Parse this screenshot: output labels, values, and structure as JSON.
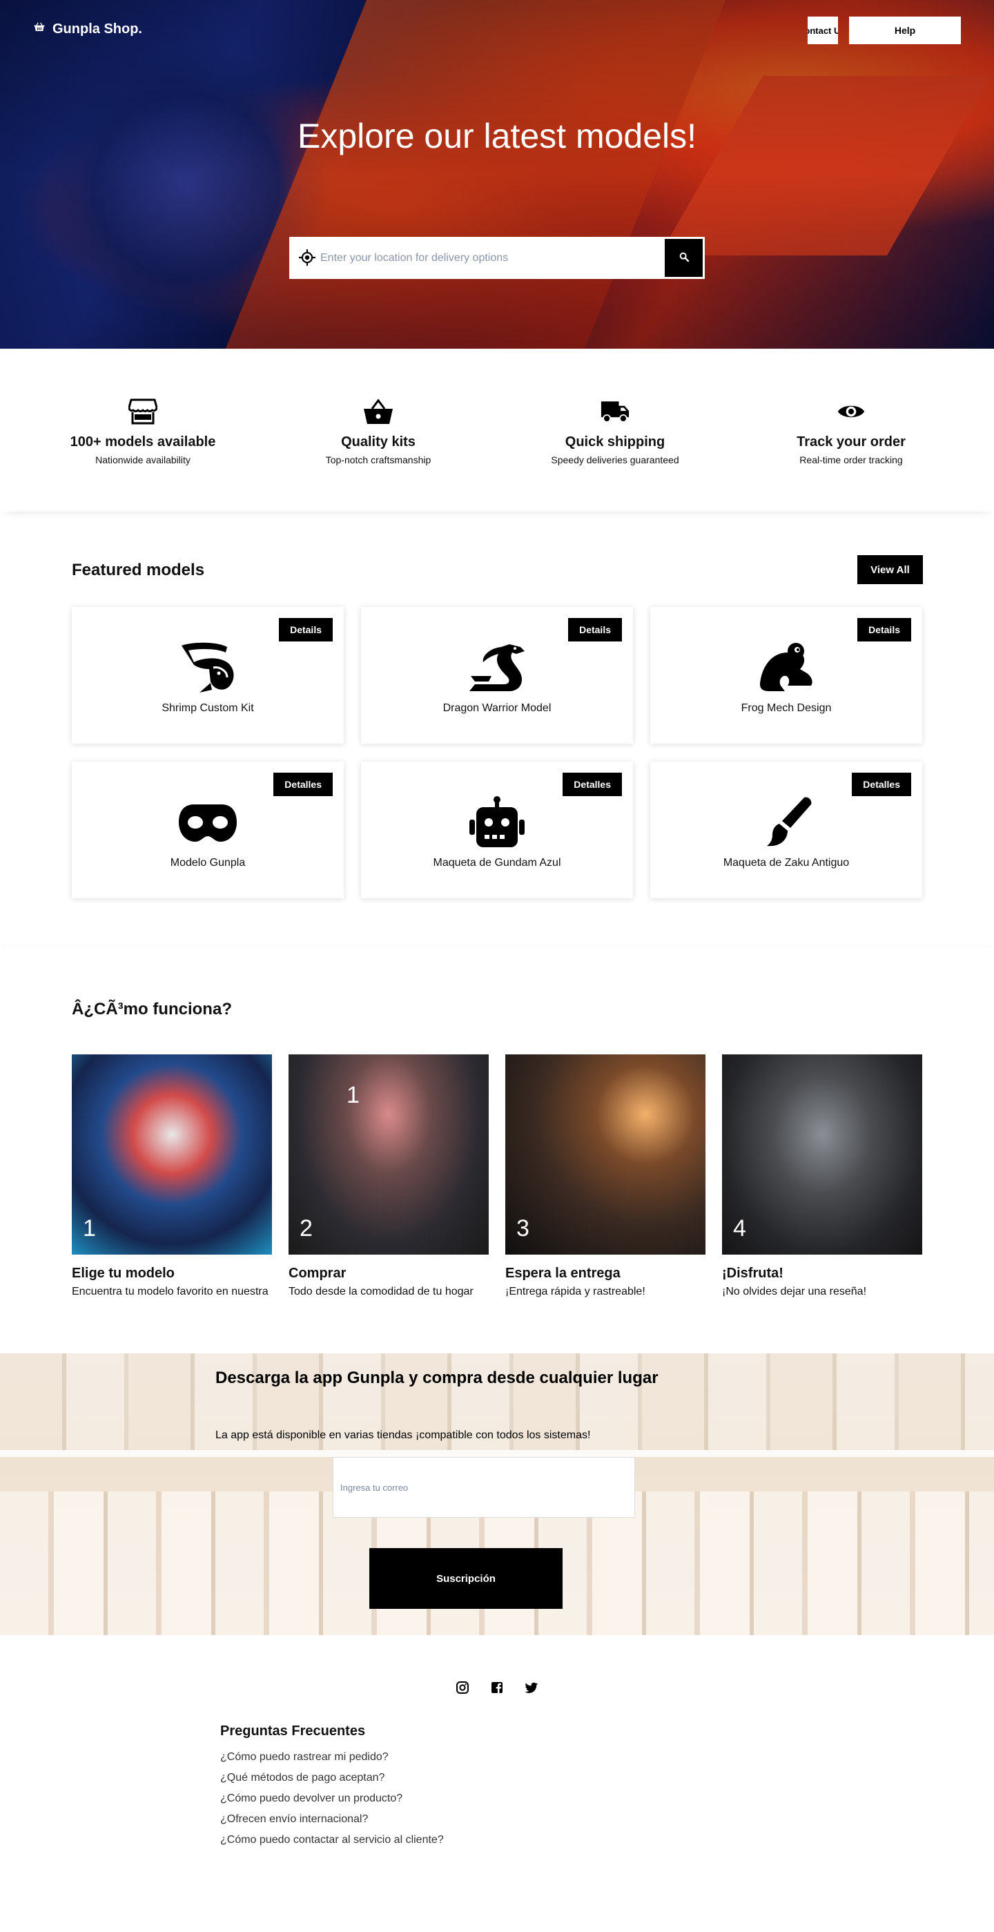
{
  "header": {
    "brand": "Gunpla Shop.",
    "nav_contact": "Contact Us",
    "nav_help": "Help"
  },
  "hero": {
    "title": "Explore our latest models!",
    "search_placeholder": "Enter your location for delivery options"
  },
  "features": [
    {
      "icon": "store-icon",
      "title": "100+ models available",
      "subtitle": "Nationwide availability"
    },
    {
      "icon": "basket-icon",
      "title": "Quality kits",
      "subtitle": "Top-notch craftsmanship"
    },
    {
      "icon": "truck-icon",
      "title": "Quick shipping",
      "subtitle": "Speedy deliveries guaranteed"
    },
    {
      "icon": "eye-icon",
      "title": "Track your order",
      "subtitle": "Real-time order tracking"
    }
  ],
  "featured": {
    "title": "Featured models",
    "view_all": "View All",
    "cards": [
      {
        "icon": "shrimp-icon",
        "name": "Shrimp Custom Kit",
        "button": "Details"
      },
      {
        "icon": "dragon-icon",
        "name": "Dragon Warrior Model",
        "button": "Details"
      },
      {
        "icon": "frog-icon",
        "name": "Frog Mech Design",
        "button": "Details"
      },
      {
        "icon": "mask-icon",
        "name": "Modelo Gunpla",
        "button": "Detalles"
      },
      {
        "icon": "robot-icon",
        "name": "Maqueta de Gundam Azul",
        "button": "Detalles"
      },
      {
        "icon": "paintbrush-icon",
        "name": "Maqueta de Zaku Antiguo",
        "button": "Detalles"
      }
    ]
  },
  "how": {
    "title": "Â¿CÃ³mo funciona?",
    "steps": [
      {
        "number": "1",
        "title": "Elige tu modelo",
        "text": "Encuentra tu modelo favorito en nuestra"
      },
      {
        "number": "1",
        "number_bottom": "2",
        "title": "Comprar",
        "text": "Todo desde la comodidad de tu hogar"
      },
      {
        "number": "3",
        "title": "Espera la entrega",
        "text": "¡Entrega rápida y rastreable!"
      },
      {
        "number": "4",
        "title": "¡Disfruta!",
        "text": "¡No olvides dejar una reseña!"
      }
    ]
  },
  "app": {
    "title": "Descarga la app Gunpla y compra desde cualquier lugar",
    "text": "La app está disponible en varias tiendas ¡compatible con todos los sistemas!",
    "email_placeholder": "Ingresa tu correo",
    "subscribe": "Suscripción"
  },
  "social": [
    "instagram-icon",
    "facebook-icon",
    "twitter-icon"
  ],
  "faq": {
    "title": "Preguntas Frecuentes",
    "items": [
      "¿Cómo puedo rastrear mi pedido?",
      "¿Qué métodos de pago aceptan?",
      "¿Cómo puedo devolver un producto?",
      "¿Ofrecen envío internacional?",
      "¿Cómo puedo contactar al servicio al cliente?"
    ]
  }
}
